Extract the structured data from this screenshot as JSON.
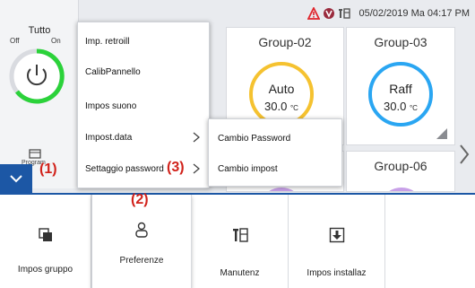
{
  "status_bar": {
    "datetime": "05/02/2019 Ma 04:17 PM",
    "icons": [
      "alarm-warning-icon",
      "shield-icon",
      "maintenance-icon"
    ]
  },
  "power_panel": {
    "title": "Tutto",
    "off_label": "Off",
    "on_label": "On",
    "state": "on"
  },
  "groups": [
    {
      "name": "Group-02",
      "mode": "Auto",
      "temperature": "30.0",
      "unit": "°C",
      "ring_color": "#f5c230"
    },
    {
      "name": "Group-03",
      "mode": "Raff",
      "temperature": "30.0",
      "unit": "°C",
      "ring_color": "#2aa6f2"
    },
    {
      "name": "Group-06"
    }
  ],
  "partial_tile": {
    "label": "Program"
  },
  "main_menu": {
    "items": [
      {
        "label": "Imp. retroill",
        "has_submenu": false
      },
      {
        "label": "CalibPannello",
        "has_submenu": false
      },
      {
        "label": "Impos suono",
        "has_submenu": false
      },
      {
        "label": "Impost.data",
        "has_submenu": true
      },
      {
        "label": "Settaggio password",
        "has_submenu": true
      }
    ]
  },
  "sub_menu": {
    "items": [
      {
        "label": "Cambio Password"
      },
      {
        "label": "Cambio impost"
      }
    ]
  },
  "bottom_bar": {
    "buttons": [
      {
        "label": "Impos gruppo",
        "icon": "group-settings-icon"
      },
      {
        "label": "Preferenze",
        "icon": "user-icon",
        "selected": true
      },
      {
        "label": "Manutenz",
        "icon": "maintenance-icon"
      },
      {
        "label": "Impos installaz",
        "icon": "install-download-icon"
      }
    ]
  },
  "annotations": [
    "(1)",
    "(2)",
    "(3)"
  ],
  "colors": {
    "accent": "#1c57a5",
    "annotation": "#d1221b",
    "power_on": "#2bd23a",
    "alarm": "#e0242b"
  }
}
